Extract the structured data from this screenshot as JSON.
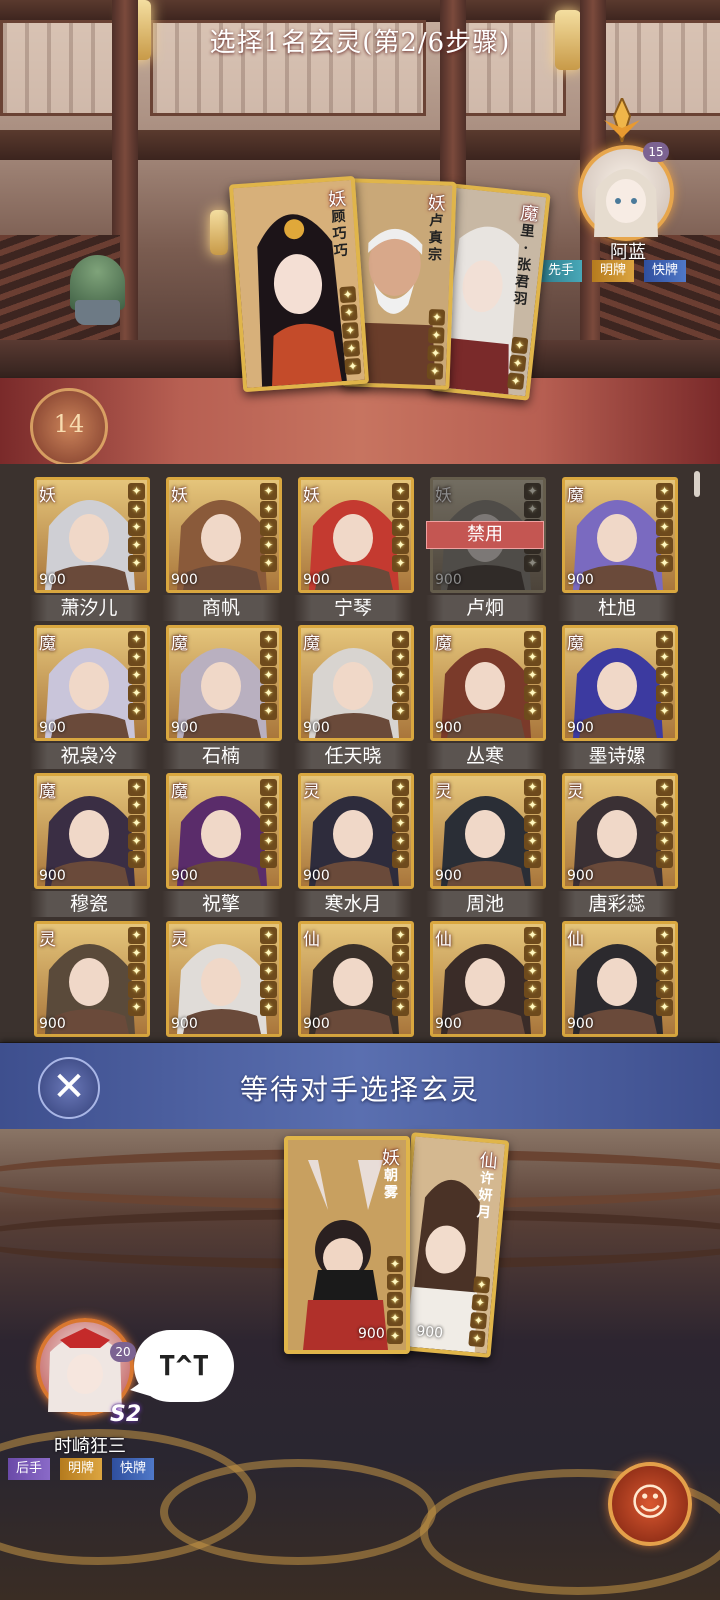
{
  "opponent": {
    "name": "阿蓝",
    "level": "15",
    "tags": {
      "first": "先手",
      "open": "明牌",
      "fast": "快牌"
    },
    "picks": [
      {
        "faction": "妖",
        "name": "顾巧巧"
      },
      {
        "faction": "妖",
        "name": "卢真宗"
      },
      {
        "faction": "魔",
        "name": "里·张君羽"
      }
    ]
  },
  "banner": {
    "turn": "14",
    "title": "选择1名玄灵(第2/6步骤)"
  },
  "grid": {
    "banned_label": "禁用",
    "cards": [
      {
        "faction": "妖",
        "cost": "900",
        "name": "萧汐儿",
        "banned": false,
        "color": "#cfcfd4"
      },
      {
        "faction": "妖",
        "cost": "900",
        "name": "商帆",
        "banned": false,
        "color": "#8a5a3a"
      },
      {
        "faction": "妖",
        "cost": "900",
        "name": "宁琴",
        "banned": false,
        "color": "#c43a30"
      },
      {
        "faction": "妖",
        "cost": "900",
        "name": "卢炯",
        "banned": true,
        "color": "#9a8a70"
      },
      {
        "faction": "魔",
        "cost": "900",
        "name": "杜旭",
        "banned": false,
        "color": "#7a6ac0"
      },
      {
        "faction": "魔",
        "cost": "900",
        "name": "祝袅冷",
        "banned": false,
        "color": "#c9c5da"
      },
      {
        "faction": "魔",
        "cost": "900",
        "name": "石楠",
        "banned": false,
        "color": "#b9b0c0"
      },
      {
        "faction": "魔",
        "cost": "900",
        "name": "任天晓",
        "banned": false,
        "color": "#d8d4d0"
      },
      {
        "faction": "魔",
        "cost": "900",
        "name": "丛寒",
        "banned": false,
        "color": "#7a3a2a"
      },
      {
        "faction": "魔",
        "cost": "900",
        "name": "墨诗嫘",
        "banned": false,
        "color": "#3c3aa0"
      },
      {
        "faction": "魔",
        "cost": "900",
        "name": "穆瓷",
        "banned": false,
        "color": "#3a2e44"
      },
      {
        "faction": "魔",
        "cost": "900",
        "name": "祝擎",
        "banned": false,
        "color": "#5a2c6a"
      },
      {
        "faction": "灵",
        "cost": "900",
        "name": "寒水月",
        "banned": false,
        "color": "#2e2c3c"
      },
      {
        "faction": "灵",
        "cost": "900",
        "name": "周池",
        "banned": false,
        "color": "#2a2e36"
      },
      {
        "faction": "灵",
        "cost": "900",
        "name": "唐彩蕊",
        "banned": false,
        "color": "#3a3034"
      },
      {
        "faction": "灵",
        "cost": "900",
        "name": "",
        "banned": false,
        "color": "#5a4a3a"
      },
      {
        "faction": "灵",
        "cost": "900",
        "name": "",
        "banned": false,
        "color": "#e0dcd8"
      },
      {
        "faction": "仙",
        "cost": "900",
        "name": "",
        "banned": false,
        "color": "#3a302a"
      },
      {
        "faction": "仙",
        "cost": "900",
        "name": "",
        "banned": false,
        "color": "#3a2c28"
      },
      {
        "faction": "仙",
        "cost": "900",
        "name": "",
        "banned": false,
        "color": "#2c2a2e"
      }
    ]
  },
  "wait": {
    "cancel_icon": "✕",
    "text": "等待对手选择玄灵"
  },
  "player": {
    "name": "时崎狂三",
    "level": "20",
    "rank": "S2",
    "speech": "T^T",
    "tags": {
      "first": "后手",
      "open": "明牌",
      "fast": "快牌"
    },
    "picks": [
      {
        "faction": "妖",
        "name": "朝雾",
        "cost": "900"
      },
      {
        "faction": "仙",
        "name": "许妍月",
        "cost": "900"
      }
    ]
  },
  "emote_icon": "☺"
}
